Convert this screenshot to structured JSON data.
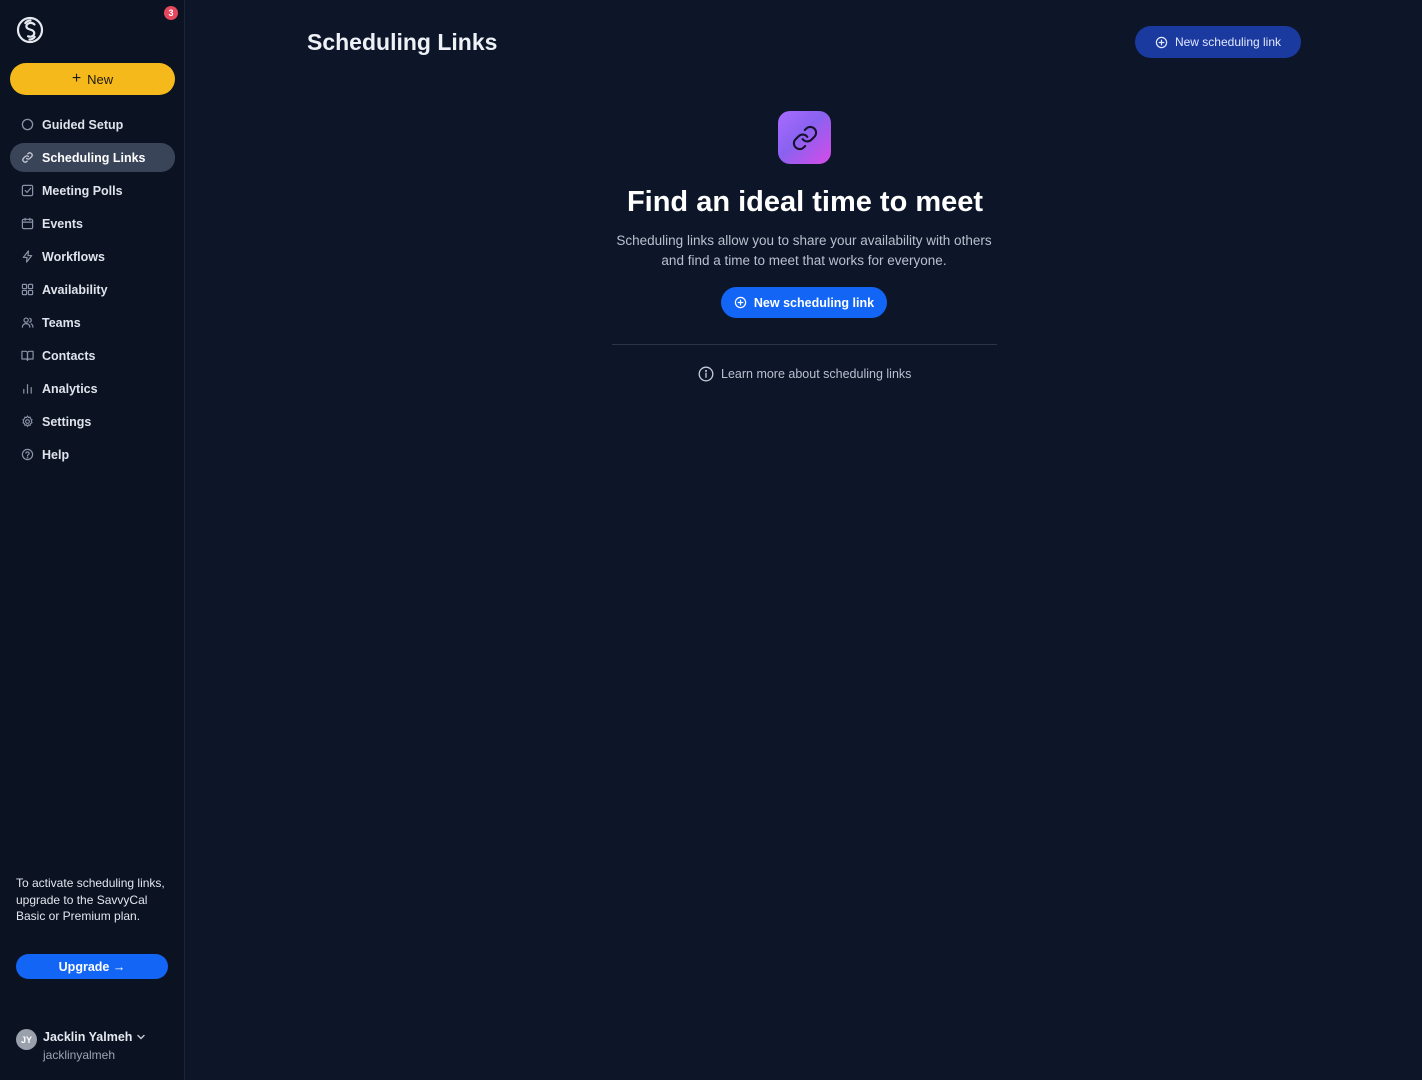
{
  "sidebar": {
    "notification_count": "3",
    "new_label": "New",
    "items": [
      {
        "label": "Guided Setup",
        "icon": "circle-icon"
      },
      {
        "label": "Scheduling Links",
        "icon": "link-icon"
      },
      {
        "label": "Meeting Polls",
        "icon": "checkbox-icon"
      },
      {
        "label": "Events",
        "icon": "calendar-icon"
      },
      {
        "label": "Workflows",
        "icon": "bolt-icon"
      },
      {
        "label": "Availability",
        "icon": "grid-icon"
      },
      {
        "label": "Teams",
        "icon": "users-icon"
      },
      {
        "label": "Contacts",
        "icon": "book-icon"
      },
      {
        "label": "Analytics",
        "icon": "bar-chart-icon"
      },
      {
        "label": "Settings",
        "icon": "gear-icon"
      },
      {
        "label": "Help",
        "icon": "question-icon"
      }
    ],
    "active_item": "Scheduling Links",
    "upsell_text": "To activate scheduling links, upgrade to the SavvyCal Basic or Premium plan.",
    "upgrade_label": "Upgrade →",
    "user": {
      "initials": "JY",
      "name": "Jacklin Yalmeh",
      "handle": "jacklinyalmeh"
    }
  },
  "main": {
    "title": "Scheduling Links",
    "top_button_label": "New scheduling link",
    "empty_state": {
      "heading": "Find an ideal time to meet",
      "description": "Scheduling links allow you to share your availability with others and find a time to meet that works for everyone.",
      "button_label": "New scheduling link",
      "learn_more_label": "Learn more about scheduling links"
    }
  },
  "colors": {
    "background": "#0d1529",
    "sidebar": "#0b1222",
    "new_button": "#f5b91c",
    "primary": "#1366f5",
    "secondary_button": "#1a3aa0",
    "badge": "#e5485d"
  }
}
